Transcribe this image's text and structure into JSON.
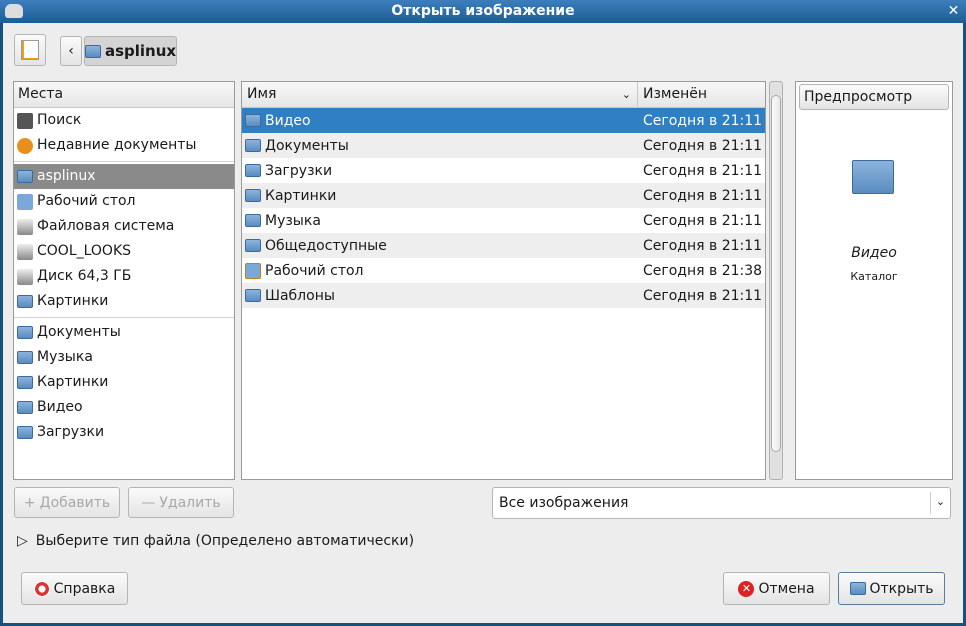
{
  "window": {
    "title": "Открыть изображение"
  },
  "toolbar": {
    "path_button": "asplinux"
  },
  "places": {
    "header": "Места",
    "items": [
      {
        "label": "Поиск",
        "icon": "binoculars-icon"
      },
      {
        "label": "Недавние документы",
        "icon": "recent-icon"
      },
      {
        "label": "asplinux",
        "icon": "home-folder-icon"
      },
      {
        "label": "Рабочий стол",
        "icon": "desktop-icon"
      },
      {
        "label": "Файловая система",
        "icon": "drive-icon"
      },
      {
        "label": "COOL_LOOKS",
        "icon": "drive-icon"
      },
      {
        "label": "Диск 64,3 ГБ",
        "icon": "drive-icon"
      },
      {
        "label": "Картинки",
        "icon": "folder-icon"
      },
      {
        "label": "Документы",
        "icon": "folder-icon"
      },
      {
        "label": "Музыка",
        "icon": "folder-icon"
      },
      {
        "label": "Картинки",
        "icon": "folder-icon"
      },
      {
        "label": "Видео",
        "icon": "folder-icon"
      },
      {
        "label": "Загрузки",
        "icon": "folder-icon"
      }
    ]
  },
  "files": {
    "col_name": "Имя",
    "col_modified": "Изменён",
    "rows": [
      {
        "name": "Видео",
        "modified": "Сегодня в 21:11"
      },
      {
        "name": "Документы",
        "modified": "Сегодня в 21:11"
      },
      {
        "name": "Загрузки",
        "modified": "Сегодня в 21:11"
      },
      {
        "name": "Картинки",
        "modified": "Сегодня в 21:11"
      },
      {
        "name": "Музыка",
        "modified": "Сегодня в 21:11"
      },
      {
        "name": "Общедоступные",
        "modified": "Сегодня в 21:11"
      },
      {
        "name": "Рабочий стол",
        "modified": "Сегодня в 21:38"
      },
      {
        "name": "Шаблоны",
        "modified": "Сегодня в 21:11"
      }
    ]
  },
  "preview": {
    "header": "Предпросмотр",
    "name": "Видео",
    "type": "Каталог"
  },
  "buttons": {
    "add": "Добавить",
    "remove": "Удалить",
    "help": "Справка",
    "cancel": "Отмена",
    "open": "Открыть"
  },
  "filter": {
    "selected": "Все изображения"
  },
  "expander": {
    "label": "Выберите тип файла (Определено автоматически)"
  }
}
